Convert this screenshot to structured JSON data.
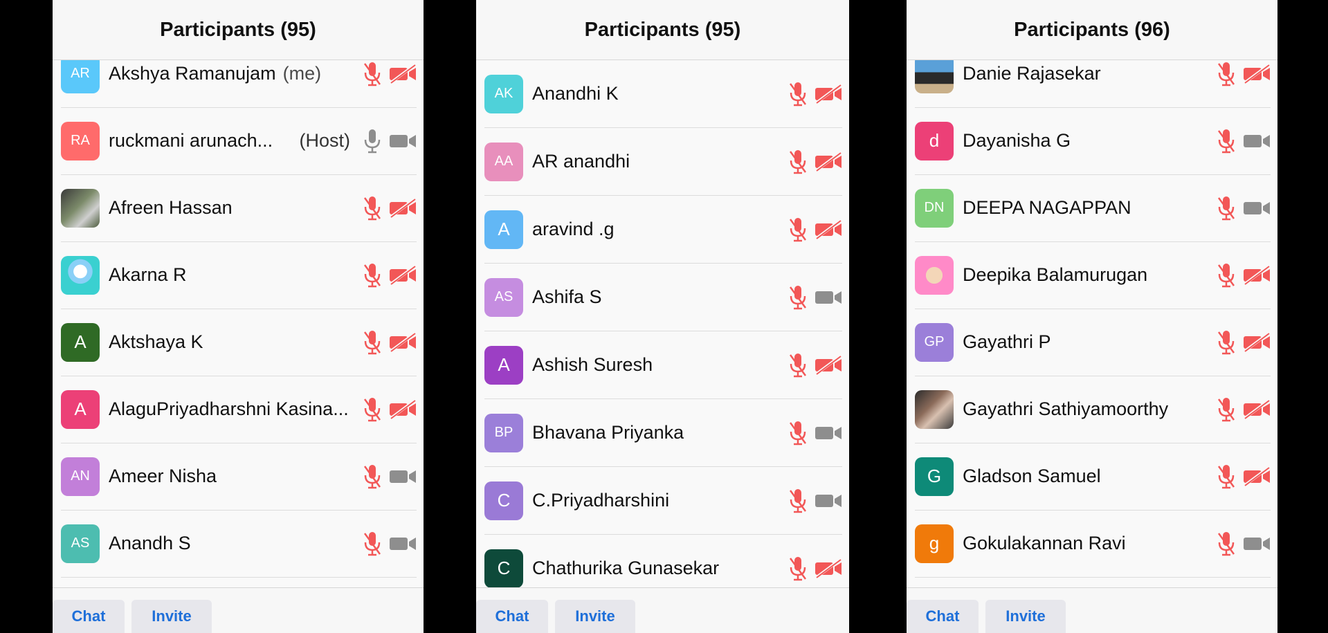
{
  "colors": {
    "muted": "#f25757",
    "active": "#8e8e8e",
    "link": "#1e6fd9"
  },
  "panels": [
    {
      "title": "Participants (95)",
      "chat_label": "Chat",
      "invite_label": "Invite",
      "rows": [
        {
          "initials": "AR",
          "avatar_color": "#5ac8fa",
          "name": "Akshya Ramanujam",
          "tag": "(me)",
          "mic_muted": true,
          "cam_off": true
        },
        {
          "initials": "RA",
          "avatar_color": "#ff6b6b",
          "name": "ruckmani arunach...",
          "host": "(Host)",
          "mic_muted": false,
          "cam_off": false
        },
        {
          "photo": "photo1",
          "avatar_color": "#777777",
          "name": "Afreen Hassan",
          "mic_muted": true,
          "cam_off": true
        },
        {
          "photo": "photo2",
          "avatar_color": "#3ad0d0",
          "name": "Akarna R",
          "mic_muted": true,
          "cam_off": true
        },
        {
          "initials": "A",
          "avatar_color": "#2f6a25",
          "name": "Aktshaya K",
          "mic_muted": true,
          "cam_off": true
        },
        {
          "initials": "A",
          "avatar_color": "#ec4077",
          "name": "AlaguPriyadharshni Kasina...",
          "mic_muted": true,
          "cam_off": true
        },
        {
          "initials": "AN",
          "avatar_color": "#c27fd9",
          "name": "Ameer Nisha",
          "mic_muted": true,
          "cam_off": false
        },
        {
          "initials": "AS",
          "avatar_color": "#4dbdb0",
          "name": "Anandh S",
          "mic_muted": true,
          "cam_off": false
        }
      ]
    },
    {
      "title": "Participants (95)",
      "chat_label": "Chat",
      "invite_label": "Invite",
      "rows": [
        {
          "initials": "AK",
          "avatar_color": "#4fd1d9",
          "name": "Anandhi K",
          "mic_muted": true,
          "cam_off": true
        },
        {
          "initials": "AA",
          "avatar_color": "#e88fbc",
          "name": "AR anandhi",
          "mic_muted": true,
          "cam_off": true
        },
        {
          "initials": "A",
          "avatar_color": "#62b7f5",
          "name": "aravind .g",
          "mic_muted": true,
          "cam_off": true
        },
        {
          "initials": "AS",
          "avatar_color": "#c58de0",
          "name": "Ashifa S",
          "mic_muted": true,
          "cam_off": false
        },
        {
          "initials": "A",
          "avatar_color": "#9c3fc4",
          "name": "Ashish Suresh",
          "mic_muted": true,
          "cam_off": true
        },
        {
          "initials": "BP",
          "avatar_color": "#9b7fd9",
          "name": "Bhavana Priyanka",
          "mic_muted": true,
          "cam_off": false
        },
        {
          "initials": "C",
          "avatar_color": "#9a7ad6",
          "name": "C.Priyadharshini",
          "mic_muted": true,
          "cam_off": false
        },
        {
          "initials": "C",
          "avatar_color": "#0e4a3a",
          "name": "Chathurika Gunasekar",
          "mic_muted": true,
          "cam_off": true
        }
      ]
    },
    {
      "title": "Participants (96)",
      "chat_label": "Chat",
      "invite_label": "Invite",
      "rows": [
        {
          "photo": "photo3",
          "avatar_color": "#5aa0d8",
          "name": "Danie Rajasekar",
          "mic_muted": true,
          "cam_off": true
        },
        {
          "initials": "d",
          "avatar_color": "#ec4077",
          "name": "Dayanisha G",
          "mic_muted": true,
          "cam_off": false
        },
        {
          "initials": "DN",
          "avatar_color": "#7fcf7a",
          "name": "DEEPA NAGAPPAN",
          "mic_muted": true,
          "cam_off": false
        },
        {
          "photo": "photo4",
          "avatar_color": "#ff8ac8",
          "name": "Deepika Balamurugan",
          "mic_muted": true,
          "cam_off": true
        },
        {
          "initials": "GP",
          "avatar_color": "#9b7fd9",
          "name": "Gayathri P",
          "mic_muted": true,
          "cam_off": true
        },
        {
          "photo": "photo5",
          "avatar_color": "#555555",
          "name": "Gayathri Sathiyamoorthy",
          "mic_muted": true,
          "cam_off": true
        },
        {
          "initials": "G",
          "avatar_color": "#0e8a78",
          "name": "Gladson Samuel",
          "mic_muted": true,
          "cam_off": true
        },
        {
          "initials": "g",
          "avatar_color": "#f07a0a",
          "name": "Gokulakannan Ravi",
          "mic_muted": true,
          "cam_off": false
        }
      ]
    }
  ]
}
